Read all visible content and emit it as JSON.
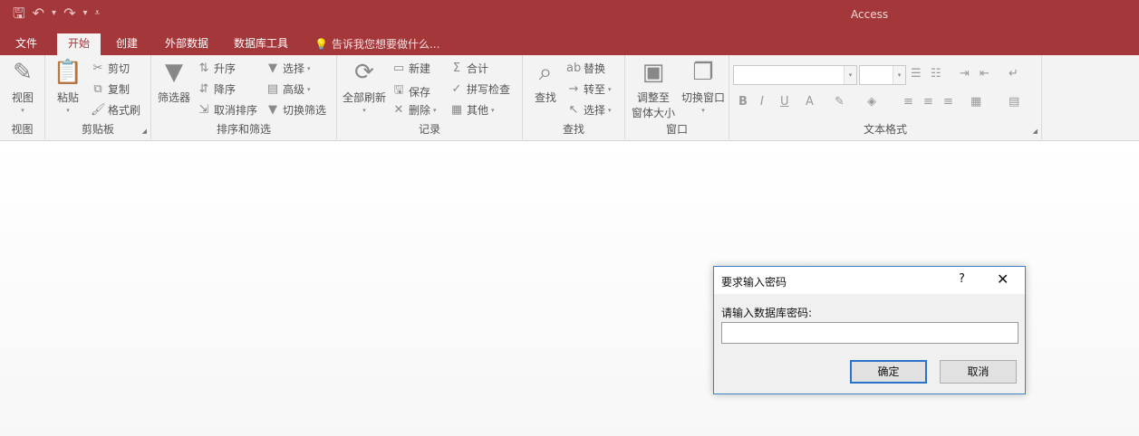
{
  "app": {
    "title": "Access"
  },
  "qat": {
    "save_icon": "save-icon",
    "undo_icon": "undo-icon",
    "redo_icon": "redo-icon",
    "customize_icon": "customize-icon"
  },
  "tabs": [
    {
      "label": "文件"
    },
    {
      "label": "开始"
    },
    {
      "label": "创建"
    },
    {
      "label": "外部数据"
    },
    {
      "label": "数据库工具"
    }
  ],
  "tellme": {
    "label": "告诉我您想要做什么..."
  },
  "ribbon": {
    "view": {
      "button": "视图",
      "label": "视图"
    },
    "clipboard": {
      "paste": "粘贴",
      "cut": "剪切",
      "copy": "复制",
      "format_painter": "格式刷",
      "label": "剪贴板"
    },
    "sort_filter": {
      "filter": "筛选器",
      "ascending": "升序",
      "descending": "降序",
      "remove_sort": "取消排序",
      "selection": "选择",
      "advanced": "高级",
      "toggle_filter": "切换筛选",
      "label": "排序和筛选"
    },
    "records": {
      "refresh_all": "全部刷新",
      "new": "新建",
      "save": "保存",
      "delete": "删除",
      "totals": "合计",
      "spelling": "拼写检查",
      "more": "其他",
      "label": "记录"
    },
    "find": {
      "find": "查找",
      "replace": "替换",
      "goto": "转至",
      "select": "选择",
      "label": "查找"
    },
    "window": {
      "size_to_fit_line1": "调整至",
      "size_to_fit_line2": "窗体大小",
      "switch_windows": "切换窗口",
      "label": "窗口"
    },
    "text_format": {
      "bold": "B",
      "italic": "I",
      "underline": "U",
      "font_color": "A",
      "label": "文本格式"
    }
  },
  "dialog": {
    "title": "要求输入密码",
    "help": "?",
    "close": "✕",
    "prompt": "请输入数据库密码:",
    "password_value": "",
    "ok": "确定",
    "cancel": "取消"
  }
}
